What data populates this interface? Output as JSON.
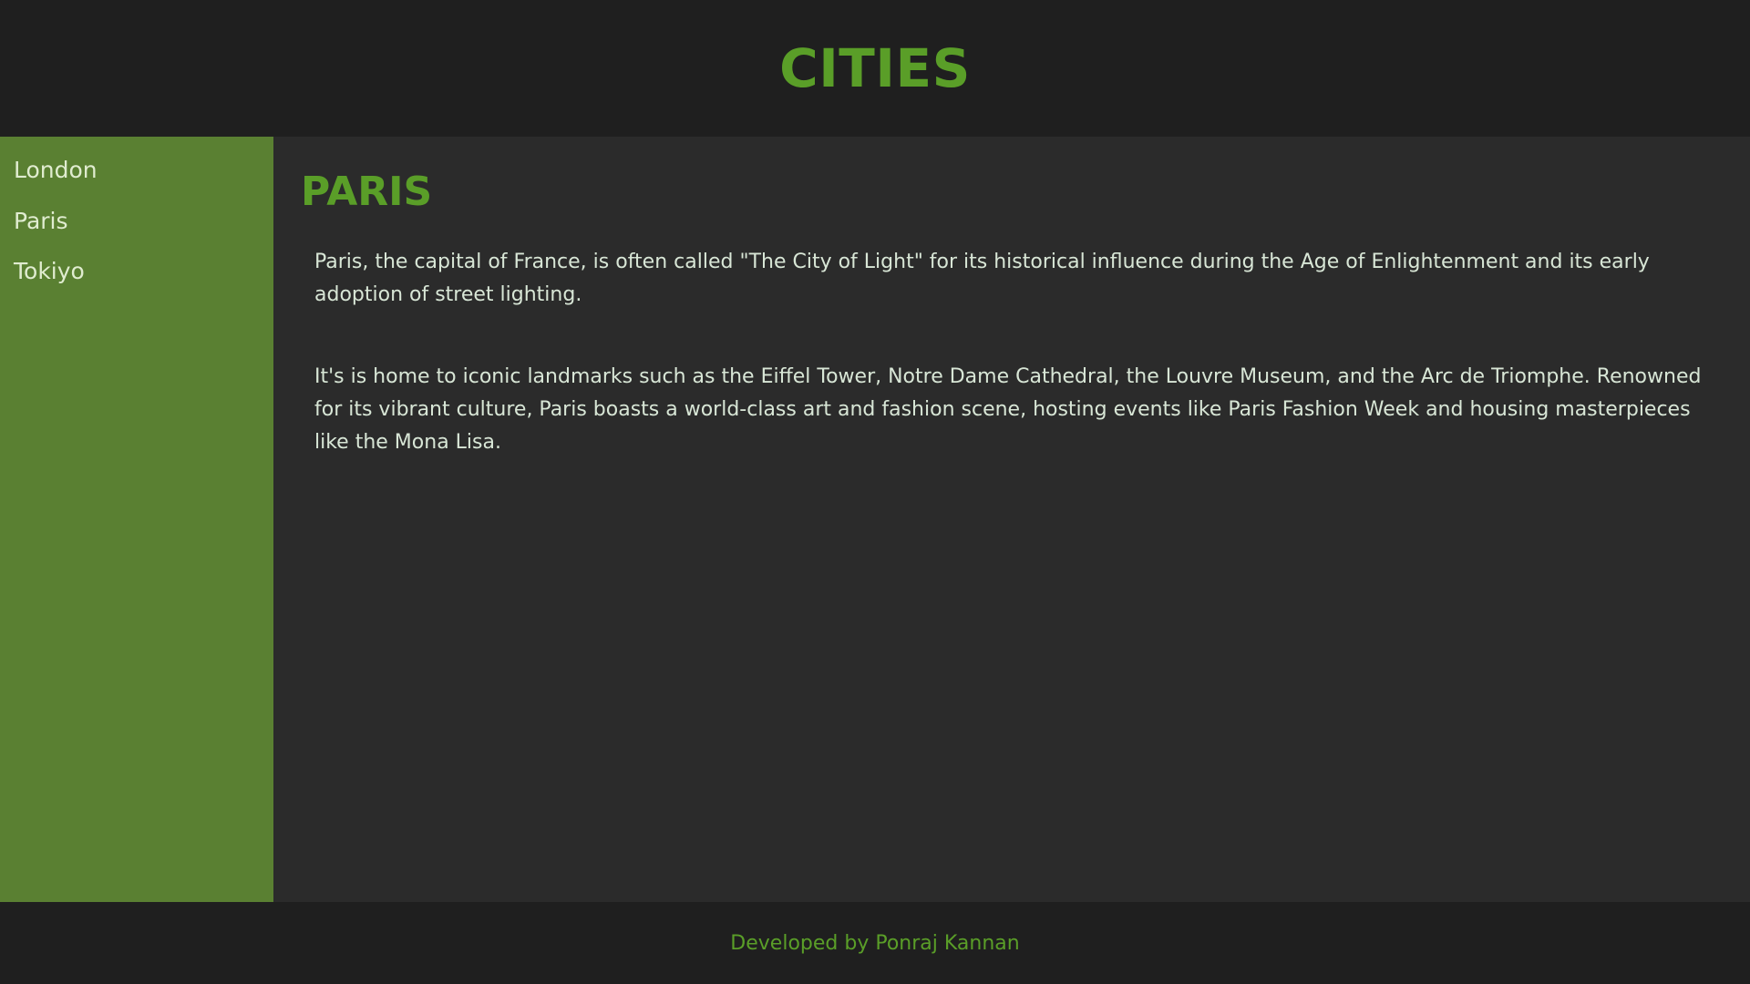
{
  "header": {
    "title": "CITIES"
  },
  "sidebar": {
    "items": [
      {
        "label": "London"
      },
      {
        "label": "Paris"
      },
      {
        "label": "Tokiyo"
      }
    ]
  },
  "main": {
    "title": "PARIS",
    "paragraphs": [
      "Paris, the capital of France, is often called \"The City of Light\" for its historical influence during the Age of Enlightenment and its early adoption of street lighting.",
      "It's is home to iconic landmarks such as the Eiffel Tower, Notre Dame Cathedral, the Louvre Museum, and the Arc de Triomphe. Renowned for its vibrant culture, Paris boasts a world-class art and fashion scene, hosting events like Paris Fashion Week and housing masterpieces like the Mona Lisa."
    ]
  },
  "footer": {
    "text": "Developed by Ponraj Kannan"
  },
  "colors": {
    "accent": "#5a9e28",
    "sidebar_bg": "#5a8032",
    "header_bg": "#1f1f1f",
    "main_bg": "#2b2b2b",
    "body_text": "#d8e6d6"
  }
}
